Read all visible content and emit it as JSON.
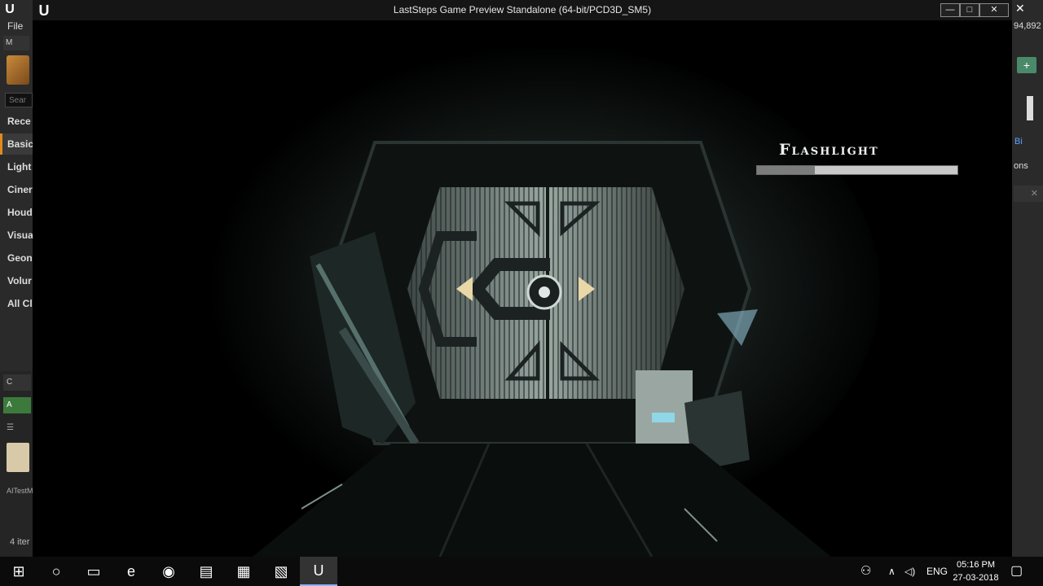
{
  "editor": {
    "logo": "U",
    "file_menu": "File",
    "tool_label": "M",
    "search_placeholder": "Sear",
    "categories": [
      "Rece",
      "Basic",
      "Light",
      "Ciner",
      "Houd",
      "Visua",
      "Geon",
      "Volur",
      "All Cl"
    ],
    "active_category_index": 1,
    "content_tab": "C",
    "add_button": "A",
    "asset_label": "AITestM",
    "item_count": "4 iter",
    "right_count": "94,892",
    "right_link": "Bi",
    "right_options": "ons"
  },
  "window": {
    "title": "LastSteps Game Preview Standalone (64-bit/PCD3D_SM5)",
    "minimize": "—",
    "maximize": "□",
    "close": "✕"
  },
  "hud": {
    "label": "Flashlight",
    "battery_fraction": 0.29,
    "bar_color": "#7c7c7c",
    "bar_bg": "#c8c8c8"
  },
  "taskbar": {
    "items": [
      {
        "name": "windows-start-icon",
        "glyph": "⊞"
      },
      {
        "name": "cortana-icon",
        "glyph": "○"
      },
      {
        "name": "task-view-icon",
        "glyph": "▭"
      },
      {
        "name": "edge-icon",
        "glyph": "e"
      },
      {
        "name": "chrome-icon",
        "glyph": "◉"
      },
      {
        "name": "file-explorer-icon",
        "glyph": "▤"
      },
      {
        "name": "store-icon",
        "glyph": "▦"
      },
      {
        "name": "app-icon",
        "glyph": "▧"
      },
      {
        "name": "unreal-engine-icon",
        "glyph": "U"
      }
    ],
    "active_index": 8,
    "tray_people": "⚇",
    "tray_chevron": "∧",
    "tray_volume": "◁)",
    "language": "ENG",
    "time": "05:16 PM",
    "date": "27-03-2018",
    "notification": "▢"
  }
}
